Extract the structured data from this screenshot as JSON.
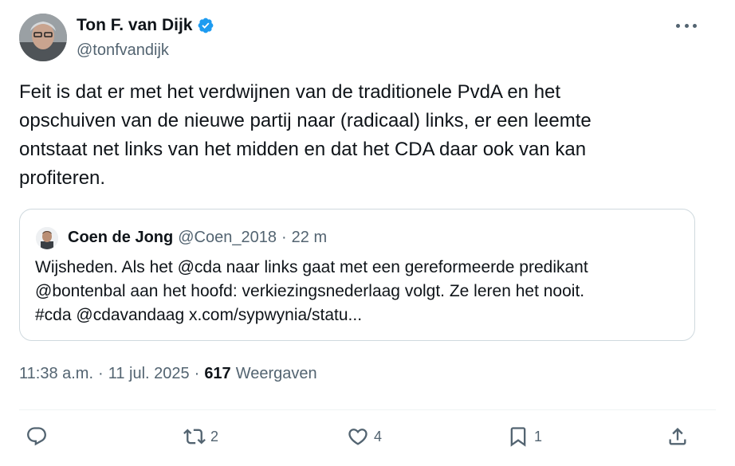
{
  "author": {
    "display_name": "Ton F. van Dijk",
    "handle": "@tonfvandijk"
  },
  "tweet": {
    "text": "Feit is dat er met het verdwijnen van de traditionele PvdA en het\nopschuiven van de nieuwe partij naar (radicaal) links, er een leemte\nontstaat net links van het midden en dat het CDA daar ook van kan\nprofiteren."
  },
  "quote": {
    "display_name": "Coen de Jong",
    "handle": "@Coen_2018",
    "separator": "·",
    "time": "22 m",
    "text": "Wijsheden. Als het @cda naar links gaat met een gereformeerde predikant\n@bontenbal aan het hoofd: verkiezingsnederlaag volgt. Ze leren het nooit.\n#cda @cdavandaag x.com/sypwynia/statu..."
  },
  "meta": {
    "time": "11:38 a.m.",
    "separator1": "·",
    "date": "11 jul. 2025",
    "separator2": "·",
    "views_count": "617",
    "views_label": "Weergaven"
  },
  "actions": {
    "reply_count": "",
    "retweet_count": "2",
    "like_count": "4",
    "bookmark_count": "1"
  },
  "icons": {
    "verified": "verified-badge-icon",
    "more": "more-icon",
    "reply": "reply-icon",
    "retweet": "retweet-icon",
    "like": "heart-icon",
    "bookmark": "bookmark-icon",
    "share": "share-icon"
  },
  "colors": {
    "verified": "#1d9bf0",
    "text_primary": "#0f1419",
    "text_secondary": "#536471",
    "border": "#cfd9de"
  }
}
